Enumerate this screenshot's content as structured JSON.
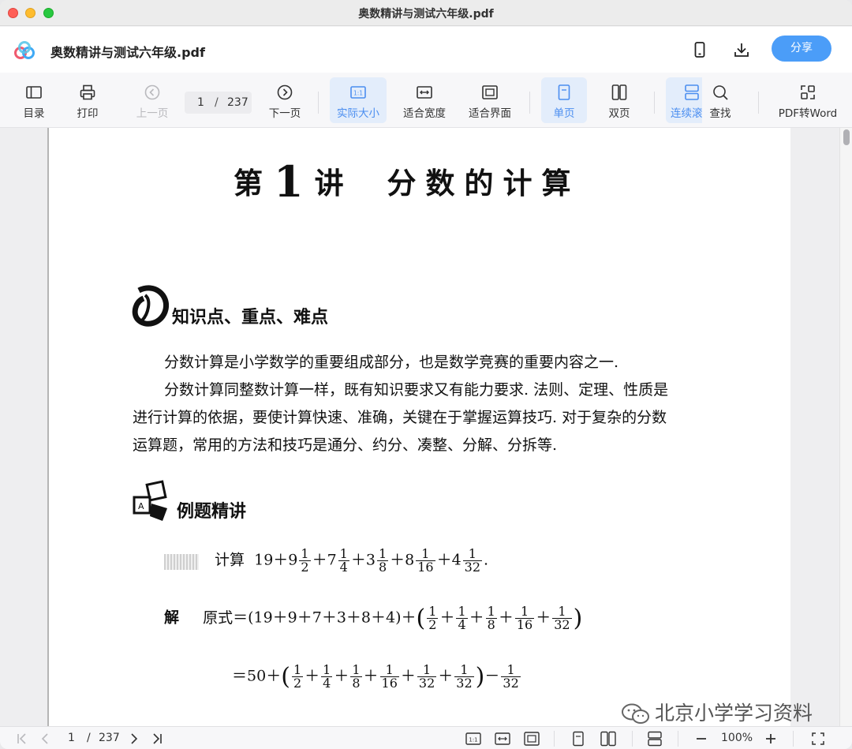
{
  "window": {
    "title": "奥数精讲与测试六年级.pdf"
  },
  "header": {
    "doc_title": "奥数精讲与测试六年级.pdf",
    "share_label": "分享"
  },
  "toolbar": {
    "toc": "目录",
    "print": "打印",
    "prev_page": "上一页",
    "page_current": "1",
    "page_sep": "/",
    "page_total": "237",
    "next_page": "下一页",
    "actual_size": "实际大小",
    "fit_width": "适合宽度",
    "fit_window": "适合界面",
    "single_page": "单页",
    "double_page": "双页",
    "continuous": "连续滚",
    "find": "查找",
    "pdf_to_word": "PDF转Word"
  },
  "document": {
    "chapter_pre": "第",
    "chapter_num": "1",
    "chapter_post": "讲",
    "chapter_title": "分数的计算",
    "section1_title": "知识点、重点、难点",
    "para1": "分数计算是小学数学的重要组成部分，也是数学竞赛的重要内容之一.",
    "para2_line1": "分数计算同整数计算一样，既有知识要求又有能力要求. 法则、定理、性质是",
    "para2_line2": "进行计算的依据，要使计算快速、准确，关键在于掌握运算技巧. 对于复杂的分数",
    "para2_line3": "运算题，常用的方法和技巧是通分、约分、凑整、分解、分拆等.",
    "section2_title": "例题精讲",
    "example_label": "计算",
    "solution_label": "解",
    "solution_prefix": "原式",
    "line3_value": "50"
  },
  "watermark": {
    "text": "北京小学学习资料"
  },
  "statusbar": {
    "page_current": "1",
    "page_sep": "/",
    "page_total": "237",
    "zoom": "100%"
  },
  "colors": {
    "accent": "#4b9df8",
    "active_bg": "#e3edfb",
    "active_text": "#4b8ef0"
  }
}
